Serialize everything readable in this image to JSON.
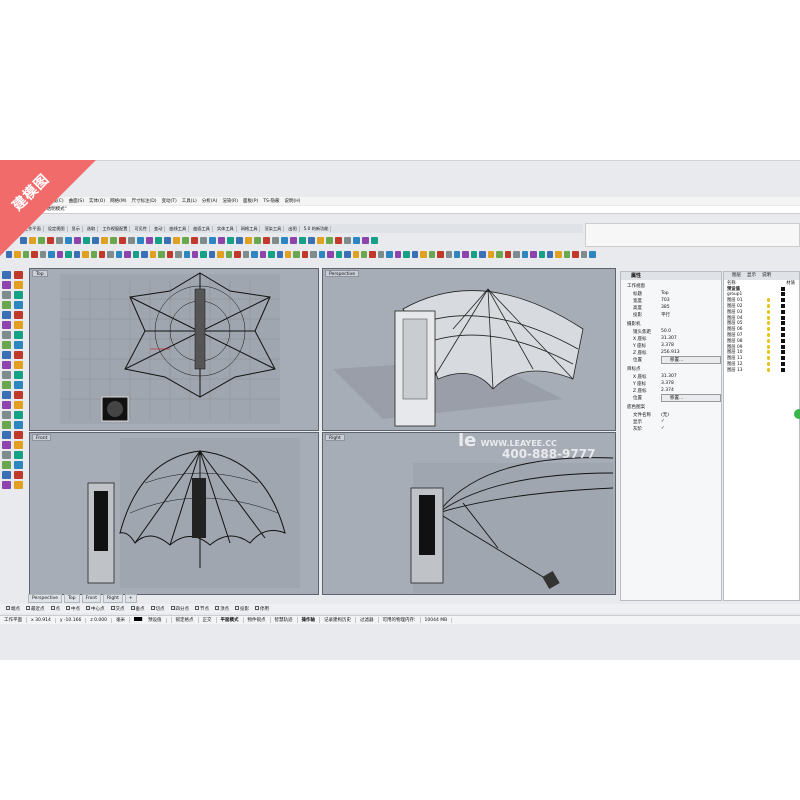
{
  "watermark": {
    "corner_text": "建模图",
    "overlay_url": "WWW.LEAYEE.CC",
    "overlay_phone": "400-888-9777",
    "overlay_brand": "le"
  },
  "menu": [
    "曲线(C)",
    "曲面(S)",
    "实体(O)",
    "网格(M)",
    "尺寸标注(D)",
    "变动(T)",
    "工具(L)",
    "分析(A)",
    "渲染(R)",
    "面板(P)",
    "TS-隐蔽",
    "说明(H)"
  ],
  "command": "\"半透明模式\"",
  "toolbar_tabs": [
    "工作平面",
    "设定视图",
    "显示",
    "选取",
    "工作视窗配置",
    "可见性",
    "变动",
    "曲线工具",
    "曲面工具",
    "实体工具",
    "网格工具",
    "渲染工具",
    "出图",
    "5.0 的新功能"
  ],
  "viewports": {
    "top": "Top",
    "perspective": "Perspective",
    "front": "Front",
    "right": "Right"
  },
  "viewport_tabs": [
    "Perspective",
    "Top",
    "Front",
    "Right"
  ],
  "osnap": [
    "端点",
    "最近点",
    "点",
    "中点",
    "中心点",
    "交点",
    "垂点",
    "切点",
    "四分点",
    "节点",
    "顶点",
    "投影",
    "停用"
  ],
  "status": {
    "cplane": "工作平面",
    "x": "x 30.914",
    "y": "y -10.166",
    "z": "z 0.000",
    "unit": "毫米",
    "layer": "预设值",
    "modes": [
      "锁定格点",
      "正交",
      "平面模式",
      "物件锁点",
      "智慧轨迹",
      "操作轴",
      "记录建构历史",
      "过滤器"
    ],
    "memory_label": "可用的物理内存:",
    "memory_value": "10044 MB"
  },
  "properties": {
    "title": "属性",
    "sec_view": "工作视窗",
    "rows_view": [
      [
        "标题",
        "Top"
      ],
      [
        "宽度",
        "703"
      ],
      [
        "高度",
        "385"
      ],
      [
        "投影",
        "平行"
      ]
    ],
    "sec_camera": "摄影机",
    "rows_camera": [
      [
        "镜头焦距",
        "50.0"
      ],
      [
        "X 座标",
        "31.307"
      ],
      [
        "Y 座标",
        "3.378"
      ],
      [
        "Z 座标",
        "256.913"
      ],
      [
        "位置",
        "移置..."
      ]
    ],
    "sec_target": "目标点",
    "rows_target": [
      [
        "X 座标",
        "31.307"
      ],
      [
        "Y 座标",
        "3.378"
      ],
      [
        "Z 座标",
        "2.374"
      ],
      [
        "位置",
        "移置..."
      ]
    ],
    "sec_bg": "底色图案",
    "rows_bg": [
      [
        "文件名称",
        "(无)"
      ],
      [
        "显示",
        "✓"
      ],
      [
        "灰阶",
        "✓"
      ]
    ]
  },
  "layers": {
    "tabs": [
      "图层",
      "显示",
      "说明"
    ],
    "col_name": "名称",
    "col_material": "材质",
    "items": [
      "预设值",
      "group1",
      "图层 01",
      "图层 02",
      "图层 03",
      "图层 04",
      "图层 05",
      "图层 06",
      "图层 07",
      "图层 08",
      "图层 09",
      "图层 10",
      "图层 11",
      "图层 12",
      "图层 13"
    ]
  }
}
